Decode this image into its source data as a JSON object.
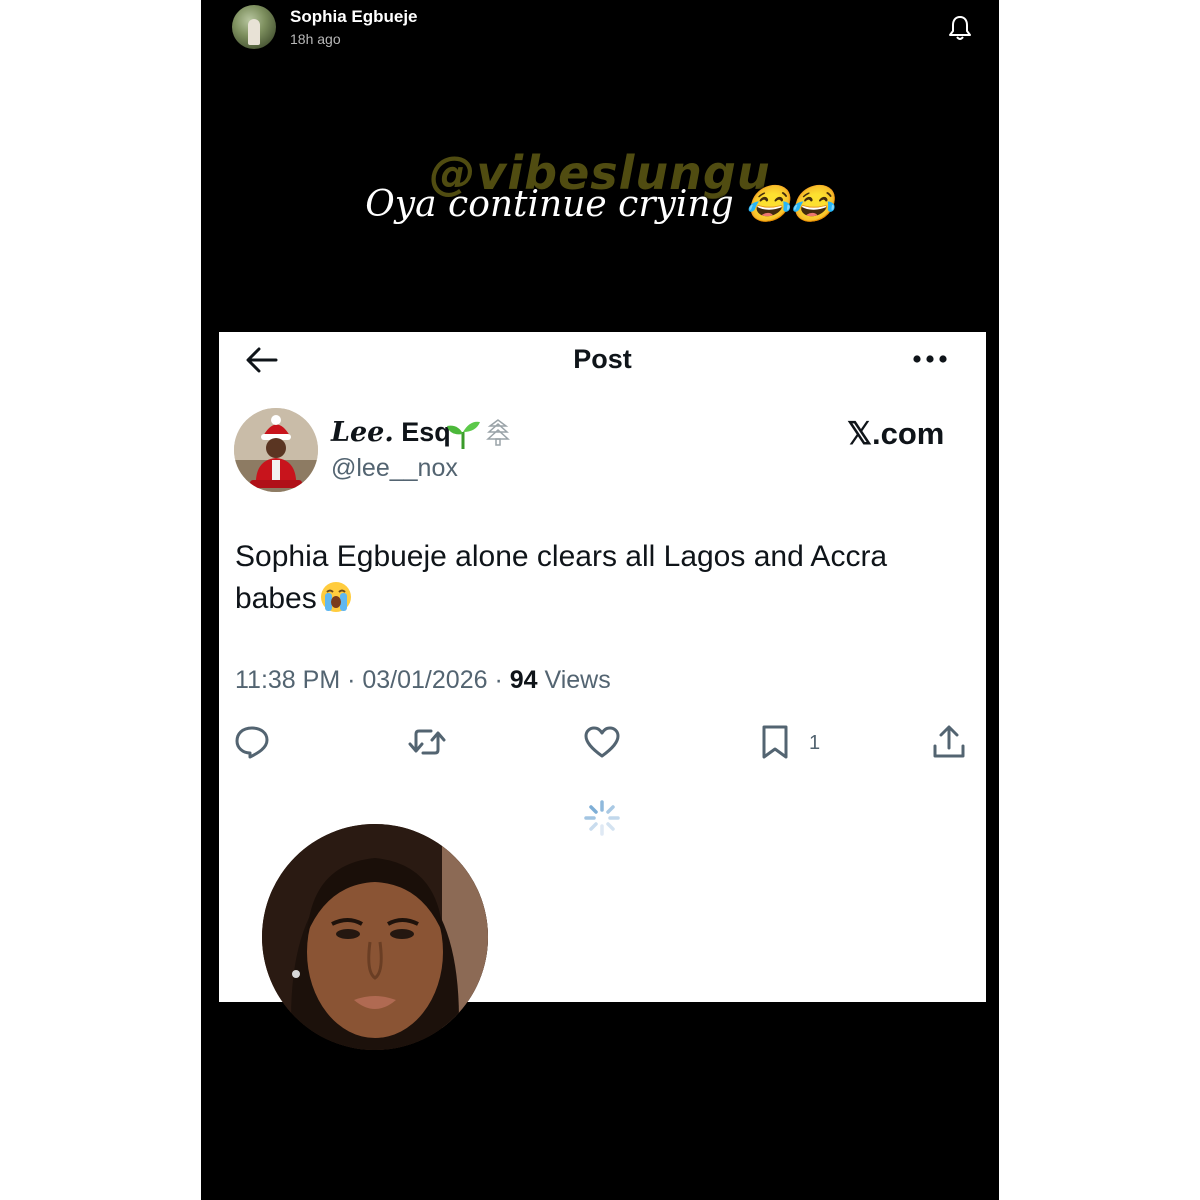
{
  "story": {
    "user_name": "Sophia Egbueje",
    "time_ago": "18h ago",
    "watermark": "@vibeslungu",
    "caption": "Oya continue crying 😂😂"
  },
  "post": {
    "header_title": "Post",
    "author_name_italic": "Lee.",
    "author_name_rest": "Esq",
    "author_handle": "@lee__nox",
    "brand": "𝕏.com",
    "text": "Sophia Egbueje alone clears all Lagos and Accra babes",
    "time": "11:38 PM",
    "date": "03/01/2026",
    "views_count": "94",
    "views_label": "Views",
    "bookmark_count": "1"
  },
  "colors": {
    "background": "#000000",
    "card": "#ffffff",
    "text_primary": "#0f1419",
    "text_secondary": "#536471",
    "watermark": "#5e5a14"
  }
}
